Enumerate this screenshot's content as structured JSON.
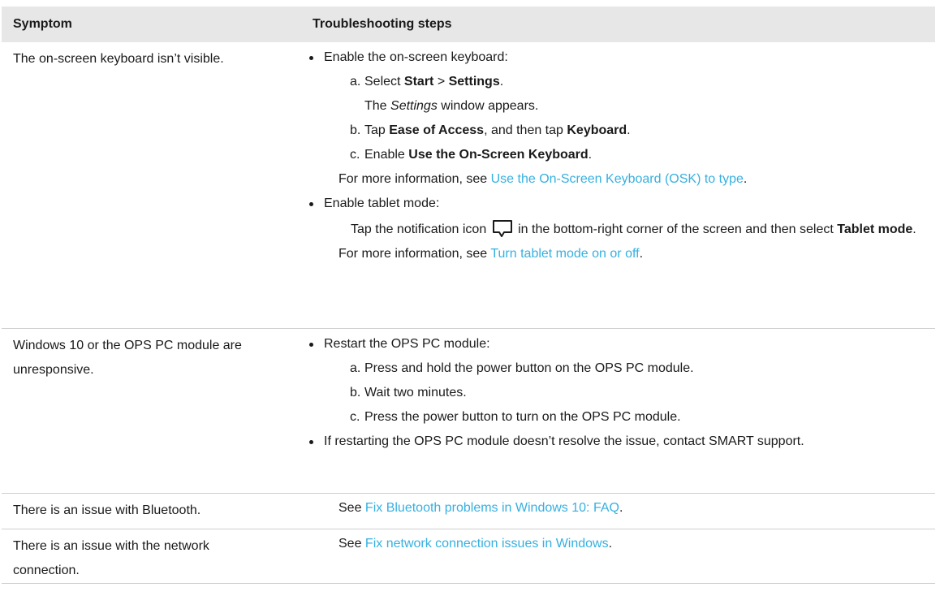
{
  "header": {
    "symptom": "Symptom",
    "steps": "Troubleshooting steps"
  },
  "row1": {
    "symptom": "The on-screen keyboard isn’t visible.",
    "bullet1": "Enable the on-screen keyboard:",
    "a_letter": "a.",
    "a_text": "Select ",
    "a_b1": "Start",
    "a_sep": " > ",
    "a_b2": "Settings",
    "a_end": ".",
    "a_note_pre": "The ",
    "a_note_i": "Settings",
    "a_note_post": " window appears.",
    "b_letter": "b.",
    "b_text": "Tap ",
    "b_b1": "Ease of Access",
    "b_mid": ", and then tap ",
    "b_b2": "Keyboard",
    "b_end": ".",
    "c_letter": "c.",
    "c_text": "Enable ",
    "c_b1": "Use the On-Screen Keyboard",
    "c_end": ".",
    "more1_pre": "For more information, see ",
    "more1_link": "Use the On-Screen Keyboard (OSK) to type",
    "more1_end": ".",
    "bullet2": "Enable tablet mode:",
    "tablet_pre": "Tap the notification icon ",
    "tablet_mid": " in the bottom-right corner of the screen and then select ",
    "tablet_b": "Tablet mode",
    "tablet_end": ".",
    "more2_pre": "For more information, see ",
    "more2_link": "Turn tablet mode on or off",
    "more2_end": "."
  },
  "row2": {
    "symptom": "Windows 10 or the OPS PC module are unresponsive.",
    "bullet1": "Restart the OPS PC module:",
    "a_letter": "a.",
    "a_text": "Press and hold the power button on the OPS PC module.",
    "b_letter": "b.",
    "b_text": "Wait two minutes.",
    "c_letter": "c.",
    "c_text": "Press the power button to turn on the OPS PC module.",
    "bullet2": "If restarting the OPS PC module doesn’t resolve the issue, contact SMART support."
  },
  "row3": {
    "symptom": "There is an issue with Bluetooth.",
    "see": "See ",
    "link": "Fix Bluetooth problems in Windows 10: FAQ",
    "end": "."
  },
  "row4": {
    "symptom": "There is an issue with the network connection.",
    "see": "See ",
    "link": "Fix network connection issues in Windows",
    "end": "."
  },
  "icons": {
    "notification": "notification-icon"
  },
  "colors": {
    "link": "#36b0e0",
    "header_bg": "#e7e7e7"
  }
}
